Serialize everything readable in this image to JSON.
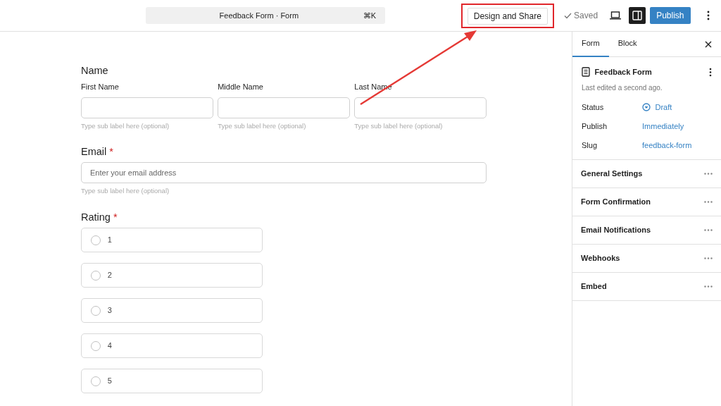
{
  "header": {
    "command_bar": {
      "title": "Feedback Form · Form",
      "shortcut": "⌘K"
    },
    "design_button": {
      "label": "Design and Share",
      "highlighted": true
    },
    "saved": "Saved",
    "sidebar_toggle": {
      "selected": true
    },
    "publish": "Publish"
  },
  "annotation": {
    "kind": "arrow"
  },
  "form": {
    "fields": [
      {
        "kind": "name",
        "label": "Name",
        "subfields": [
          {
            "label": "First Name",
            "help": "Type sub label here (optional)"
          },
          {
            "label": "Middle Name",
            "help": "Type sub label here (optional)"
          },
          {
            "label": "Last Name",
            "help": "Type sub label here (optional)"
          }
        ]
      },
      {
        "kind": "email",
        "label": "Email",
        "required_mark": "*",
        "placeholder": "Enter your email address",
        "help": "Type sub label here (optional)"
      },
      {
        "kind": "radio",
        "label": "Rating",
        "required_mark": "*",
        "options": [
          {
            "label": "1",
            "selected": false
          },
          {
            "label": "2",
            "selected": false
          },
          {
            "label": "3",
            "selected": false
          },
          {
            "label": "4",
            "selected": false
          },
          {
            "label": "5",
            "selected": false
          }
        ]
      }
    ]
  },
  "sidebar": {
    "tabs": [
      {
        "label": "Form",
        "selected": true
      },
      {
        "label": "Block",
        "selected": false
      }
    ],
    "summary": {
      "title": "Feedback Form",
      "last_edited": "Last edited a second ago.",
      "rows": [
        {
          "label": "Status",
          "value": "Draft",
          "kind": "status"
        },
        {
          "label": "Publish",
          "value": "Immediately",
          "kind": "link"
        },
        {
          "label": "Slug",
          "value": "feedback-form",
          "kind": "link"
        }
      ]
    },
    "sections": [
      {
        "title": "General Settings"
      },
      {
        "title": "Form Confirmation"
      },
      {
        "title": "Email Notifications"
      },
      {
        "title": "Webhooks"
      },
      {
        "title": "Embed"
      }
    ]
  }
}
